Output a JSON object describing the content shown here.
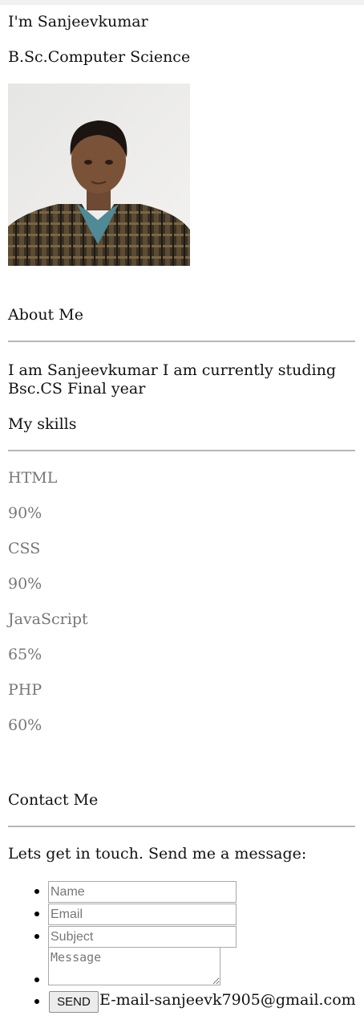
{
  "intro": {
    "name_line": "I'm Sanjeevkumar",
    "degree": "B.Sc.Computer Science"
  },
  "about": {
    "heading": "About Me",
    "text": "I am Sanjeevkumar I am currently studing Bsc.CS Final year"
  },
  "skills": {
    "heading": "My skills",
    "items": [
      {
        "name": "HTML",
        "percent": "90%"
      },
      {
        "name": "CSS",
        "percent": "90%"
      },
      {
        "name": "JavaScript",
        "percent": "65%"
      },
      {
        "name": "PHP",
        "percent": "60%"
      }
    ]
  },
  "contact": {
    "heading": "Contact Me",
    "intro": "Lets get in touch. Send me a message:",
    "name_placeholder": "Name",
    "email_placeholder": "Email",
    "subject_placeholder": "Subject",
    "message_placeholder": "Message",
    "send_label": "SEND",
    "email_text": "E-mail-sanjeevk7905@gmail.com"
  },
  "colors": {
    "rule": "#b7b7b7",
    "skill_text": "#777777"
  }
}
